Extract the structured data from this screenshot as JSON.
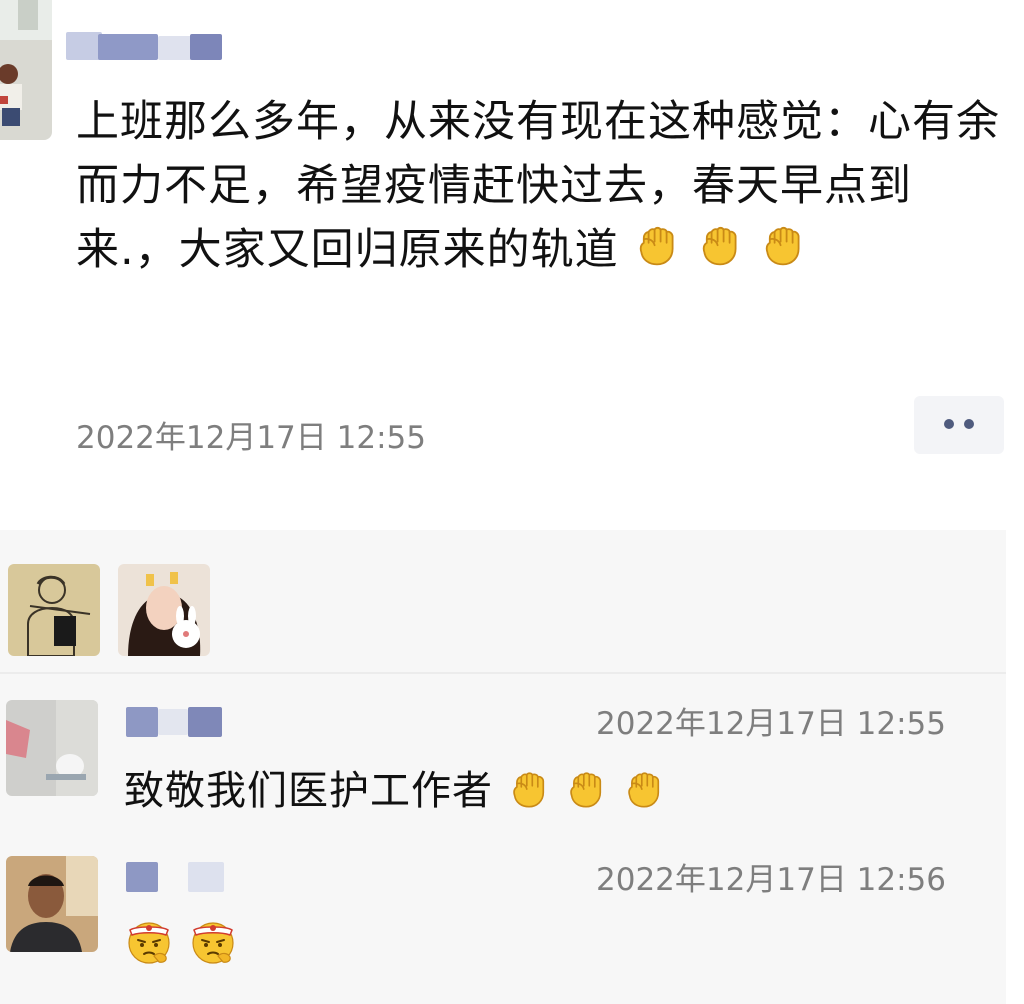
{
  "post": {
    "text": "上班那么多年，从来没有现在这种感觉：心有余而力不足，希望疫情赶快过去，春天早点到来.，大家又回归原来的轨道",
    "text_emojis": [
      "fist-emoji",
      "fist-emoji",
      "fist-emoji"
    ],
    "timestamp": "2022年12月17日 12:55",
    "more_icon": "more-dots-icon"
  },
  "likes": {
    "avatars": [
      "sketch-avatar",
      "girl-with-bunny-avatar"
    ]
  },
  "comments": [
    {
      "text": "致敬我们医护工作者",
      "emojis": [
        "fist-emoji",
        "fist-emoji",
        "fist-emoji"
      ],
      "timestamp": "2022年12月17日 12:55"
    },
    {
      "text": "",
      "emojis": [
        "determined-face-emoji",
        "determined-face-emoji"
      ],
      "timestamp": "2022年12月17日 12:56"
    }
  ],
  "colors": {
    "text": "#111111",
    "timestamp": "#7e7e7e",
    "interaction_bg": "#f7f7f7",
    "more_dots": "#4f5b7e",
    "emoji_yellow": "#f7c531"
  }
}
